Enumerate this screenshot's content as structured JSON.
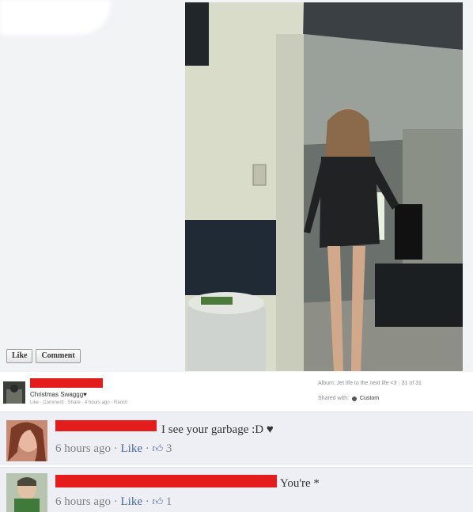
{
  "post": {
    "like_label": "Like",
    "comment_label": "Comment"
  },
  "photo_info": {
    "album_text": "Album: Jet life to the next life <3 · 31 of 31",
    "shared_with_label": "Shared with:",
    "privacy": "Custom",
    "album_name": "Christmas Swaggg♥",
    "album_actions": "Like · Comment · Share · 4 hours ago · Ranch"
  },
  "comments": [
    {
      "text": "I see your garbage :D ♥",
      "time": "6 hours ago",
      "like_label": "Like",
      "likes": "3"
    },
    {
      "text": "You're *",
      "time": "6 hours ago",
      "like_label": "Like",
      "likes": "1"
    }
  ],
  "colors": {
    "redaction": "#e41c1c",
    "link": "#4c66a4",
    "comment_bg": "#edeff4"
  }
}
